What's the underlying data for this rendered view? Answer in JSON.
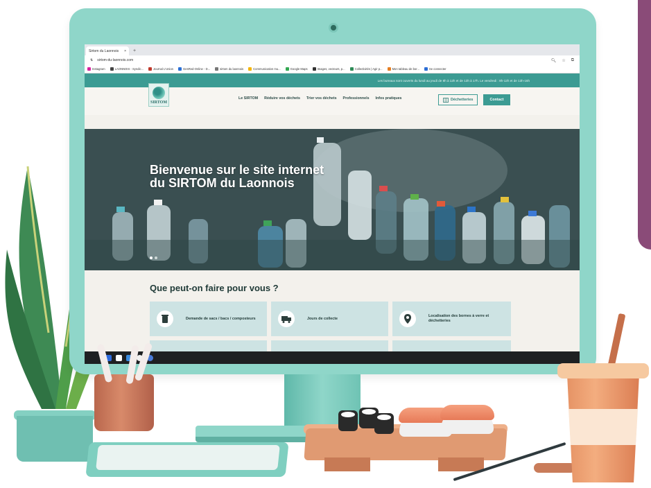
{
  "browser": {
    "tab_title": "Sirtom du Laonnois",
    "tab_close": "×",
    "new_tab": "+",
    "url": "sirtom-du-laonnois.com",
    "bookmarks": [
      {
        "label": "Instagram",
        "color": "#d6249f"
      },
      {
        "label": "LAONNOIS - Syndic...",
        "color": "#444444"
      },
      {
        "label": "Journal L'Union",
        "color": "#c0392b"
      },
      {
        "label": "GesRed-Online - D...",
        "color": "#2a6fd6"
      },
      {
        "label": "sirtom du laonnois",
        "color": "#777777"
      },
      {
        "label": "Communication mu...",
        "color": "#f4b400"
      },
      {
        "label": "Google Maps",
        "color": "#34a853"
      },
      {
        "label": "Images, vecteurs, p...",
        "color": "#333333"
      },
      {
        "label": "Collectivités | Agir p...",
        "color": "#2e8b57"
      },
      {
        "label": "Mon tableau de bor...",
        "color": "#e67e22"
      },
      {
        "label": "Se connecter",
        "color": "#2c6ed5"
      }
    ]
  },
  "site": {
    "topbar_text": "Les bureaux sont ouverts du lundi au jeudi de 8h à 12h et de 13h à 17h. Le vendredi : 8h-12h et de 13h-16h",
    "logo_text": "SIRTOM",
    "nav": [
      "Le SIRTOM",
      "Réduire vos déchets",
      "Trier vos déchets",
      "Professionnels",
      "Infos pratiques"
    ],
    "btn_decheteries": "Déchetteries",
    "btn_contact": "Contact",
    "hero_title": "Bienvenue sur le site internet du SIRTOM du Laonnois",
    "services_title": "Que peut-on faire pour vous ?",
    "cards": [
      {
        "label": "Demande de sacs / bacs / composteurs",
        "icon": "trash-bin-icon"
      },
      {
        "label": "Jours de collecte",
        "icon": "truck-icon"
      },
      {
        "label": "Localisation des bornes à verre et déchetteries",
        "icon": "map-pin-icon"
      }
    ]
  },
  "colors": {
    "monitor": "#8fd6c9",
    "accent": "#3c9b93",
    "card_bg": "#cde3e3",
    "accent_purple": "#8a4b78"
  }
}
